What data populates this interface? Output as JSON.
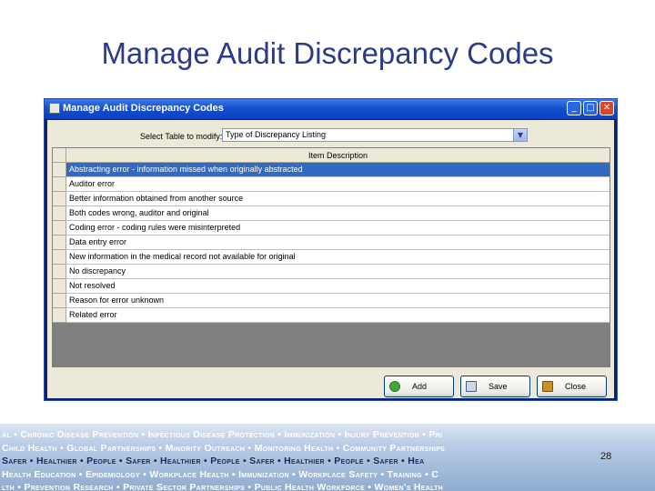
{
  "slide": {
    "title": "Manage Audit Discrepancy Codes",
    "page_number": "28"
  },
  "window": {
    "title": "Manage Audit Discrepancy Codes",
    "controls": {
      "minimize": "_",
      "maximize": "□",
      "close": "✕"
    }
  },
  "form": {
    "select_label": "Select Table to modify:",
    "select_value": "Type of Discrepancy Listing"
  },
  "table": {
    "header": "Item Description",
    "rows": [
      "Abstracting error - information missed when originally abstracted",
      "Auditor error",
      "Better information obtained from another source",
      "Both codes wrong, auditor and original",
      "Coding error - coding rules were misinterpreted",
      "Data entry error",
      "New information in the medical record not available for original",
      "No discrepancy",
      "Not resolved",
      "Reason for error unknown",
      "Related error"
    ],
    "selected_index": 0
  },
  "buttons": {
    "add": "Add",
    "save": "Save",
    "close": "Close"
  },
  "banner": {
    "lines": [
      "al • Chronic Disease Prevention • Infectious Disease Protection • Immunization • Injury Prevention • Pri",
      "Child Health • Global Partnerships • Minority Outreach • Monitoring Health • Community Partnerships",
      "Safer • Healthier • People • Safer • Healthier • People • Safer • Healthier • People • Safer • Hea",
      "Health Education • Epidemiology • Workplace Health • Immunization • Workplace Safety • Training • C",
      "lth • Prevention Research • Private Sector Partnerships • Public Health Workforce • Women's Health"
    ]
  },
  "colors": {
    "title": "#2b3b8c",
    "selection": "#316ac5",
    "titlebar": "#1450d0"
  }
}
